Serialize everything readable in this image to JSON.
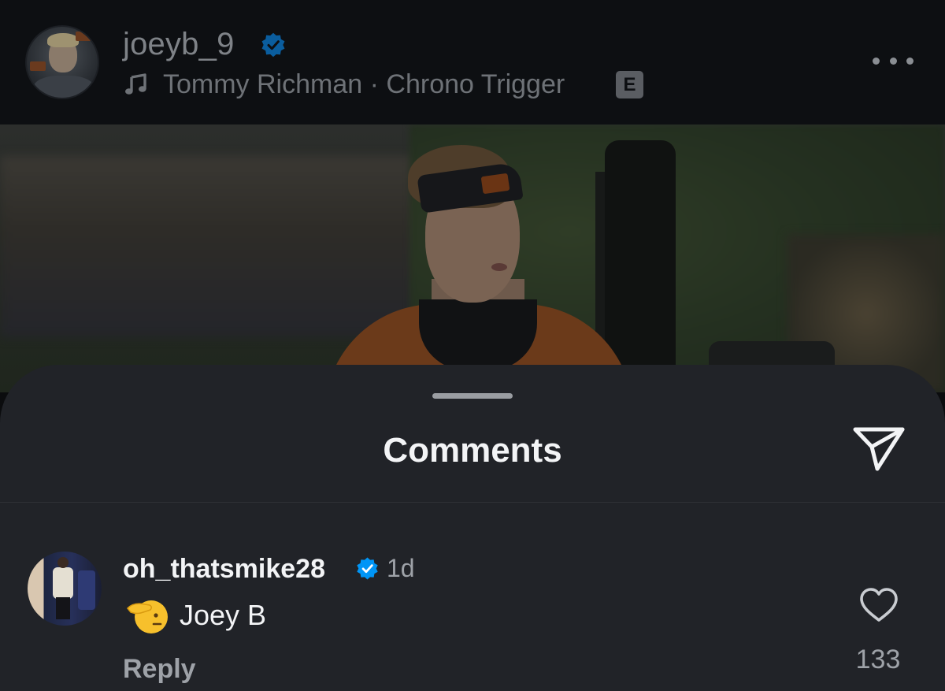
{
  "post": {
    "username": "joeyb_9",
    "verified": true,
    "audio": {
      "artist": "Tommy Richman",
      "separator": "·",
      "track": "Chrono Trigger",
      "explicit_label": "E"
    },
    "more_icon": "more-horizontal-icon"
  },
  "comments_sheet": {
    "title": "Comments",
    "share_icon": "paper-plane-icon",
    "comments": [
      {
        "username": "oh_thatsmike28",
        "verified": true,
        "time": "1d",
        "emoji": "saluting-face",
        "text": "Joey B",
        "reply_label": "Reply",
        "like_icon": "heart-outline-icon",
        "like_count": "133"
      }
    ]
  },
  "colors": {
    "sheet_background": "#212328",
    "header_background": "#0d0f12",
    "verified_blue": "#0095f6",
    "primary_text": "#f3f4f6",
    "secondary_text": "#9ea2a8"
  }
}
